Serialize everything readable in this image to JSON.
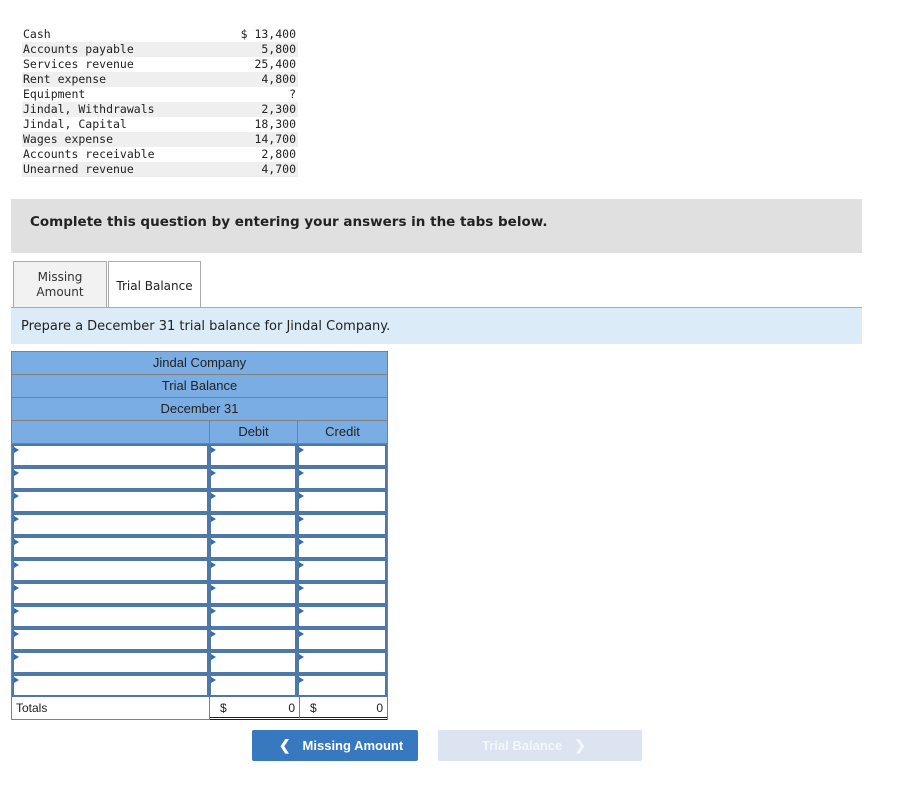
{
  "given_data": [
    {
      "account": "Cash",
      "amount": "$ 13,400"
    },
    {
      "account": "Accounts payable",
      "amount": "5,800"
    },
    {
      "account": "Services revenue",
      "amount": "25,400"
    },
    {
      "account": "Rent expense",
      "amount": "4,800"
    },
    {
      "account": "Equipment",
      "amount": "?"
    },
    {
      "account": "Jindal, Withdrawals",
      "amount": "2,300"
    },
    {
      "account": "Jindal, Capital",
      "amount": "18,300"
    },
    {
      "account": "Wages expense",
      "amount": "14,700"
    },
    {
      "account": "Accounts receivable",
      "amount": "2,800"
    },
    {
      "account": "Unearned revenue",
      "amount": "4,700"
    }
  ],
  "banner": "Complete this question by entering your answers in the tabs below.",
  "tabs": [
    {
      "label_line1": "Missing",
      "label_line2": "Amount",
      "active": false
    },
    {
      "label": "Trial Balance",
      "active": true
    }
  ],
  "prompt": "Prepare a December 31 trial balance for Jindal Company.",
  "trial_balance": {
    "company": "Jindal Company",
    "title": "Trial Balance",
    "date": "December 31",
    "columns": {
      "account": "",
      "debit": "Debit",
      "credit": "Credit"
    },
    "row_count": 11,
    "rows": [
      {
        "account": "",
        "debit": "",
        "credit": ""
      },
      {
        "account": "",
        "debit": "",
        "credit": ""
      },
      {
        "account": "",
        "debit": "",
        "credit": ""
      },
      {
        "account": "",
        "debit": "",
        "credit": ""
      },
      {
        "account": "",
        "debit": "",
        "credit": ""
      },
      {
        "account": "",
        "debit": "",
        "credit": ""
      },
      {
        "account": "",
        "debit": "",
        "credit": ""
      },
      {
        "account": "",
        "debit": "",
        "credit": ""
      },
      {
        "account": "",
        "debit": "",
        "credit": ""
      },
      {
        "account": "",
        "debit": "",
        "credit": ""
      },
      {
        "account": "",
        "debit": "",
        "credit": ""
      }
    ],
    "totals": {
      "label": "Totals",
      "currency": "$",
      "debit": "0",
      "credit": "0"
    }
  },
  "nav": {
    "prev_label": "Missing Amount",
    "prev_icon": "chevron-left-icon",
    "next_label": "Trial Balance",
    "next_icon": "chevron-right-icon"
  },
  "colors": {
    "header_blue": "#7aade3",
    "cell_border": "#4d78a8",
    "prev_button": "#3878bf",
    "next_button_disabled": "#dbe4f0",
    "prompt_bg": "#dcebf8",
    "banner_bg": "#e0e0e0"
  }
}
